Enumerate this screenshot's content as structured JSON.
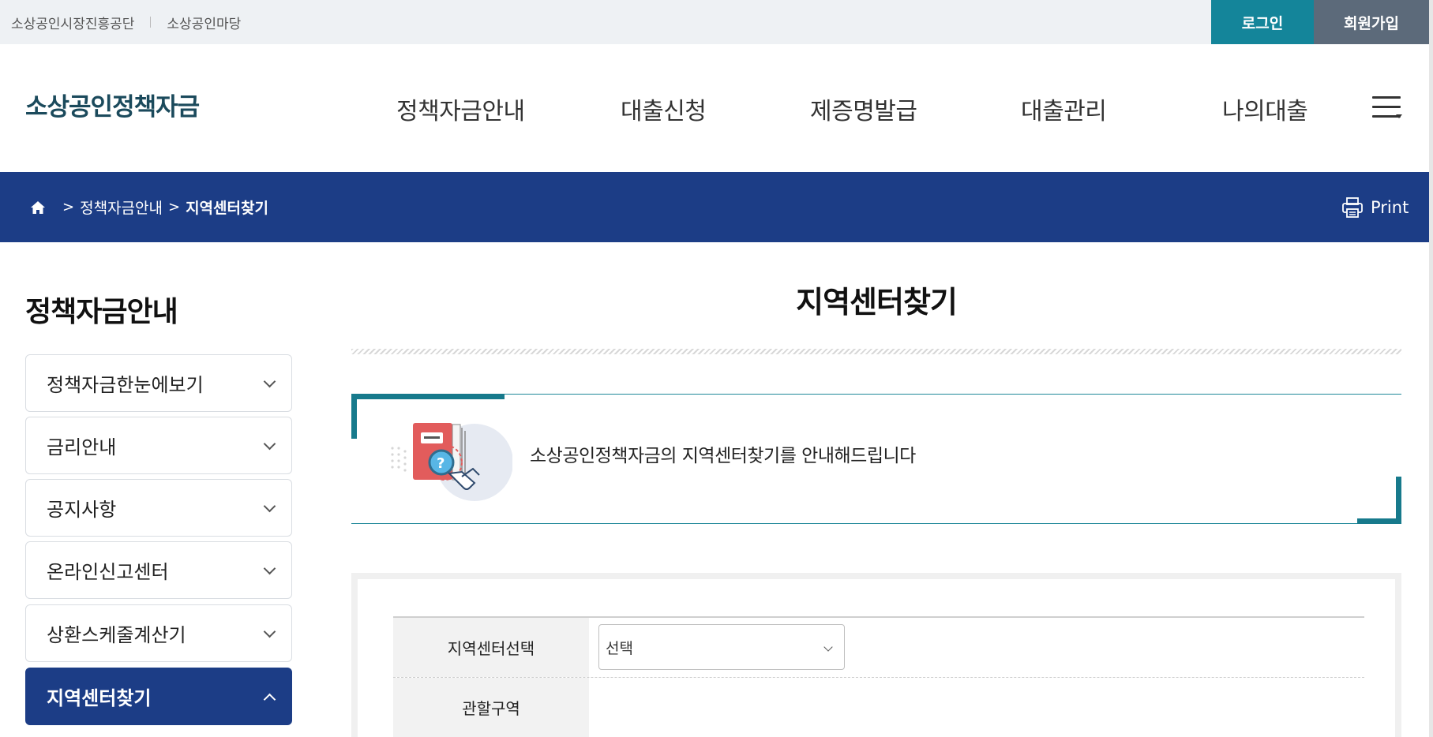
{
  "topbar": {
    "links": [
      "소상공인시장진흥공단",
      "소상공인마당"
    ],
    "login_label": "로그인",
    "join_label": "회원가입"
  },
  "header": {
    "logo": "소상공인정책자금",
    "nav": [
      "정책자금안내",
      "대출신청",
      "제증명발급",
      "대출관리",
      "나의대출"
    ]
  },
  "breadcrumb": {
    "items": [
      "정책자금안내",
      "지역센터찾기"
    ],
    "print_label": "Print"
  },
  "sidebar": {
    "title": "정책자금안내",
    "items": [
      {
        "label": "정책자금한눈에보기"
      },
      {
        "label": "금리안내"
      },
      {
        "label": "공지사항"
      },
      {
        "label": "온라인신고센터"
      },
      {
        "label": "상환스케줄계산기"
      },
      {
        "label": "지역센터찾기",
        "active": true
      }
    ]
  },
  "main": {
    "title": "지역센터찾기",
    "intro_text": "소상공인정책자금의 지역센터찾기를 안내해드립니다",
    "form": {
      "center_select_label": "지역센터선택",
      "center_select_value": "선택",
      "jurisdiction_label": "관할구역",
      "jurisdiction_value": ""
    }
  },
  "colors": {
    "navy": "#1c3d86",
    "teal": "#14859a",
    "slate": "#5c6a7a",
    "logo": "#1b4a5c"
  }
}
